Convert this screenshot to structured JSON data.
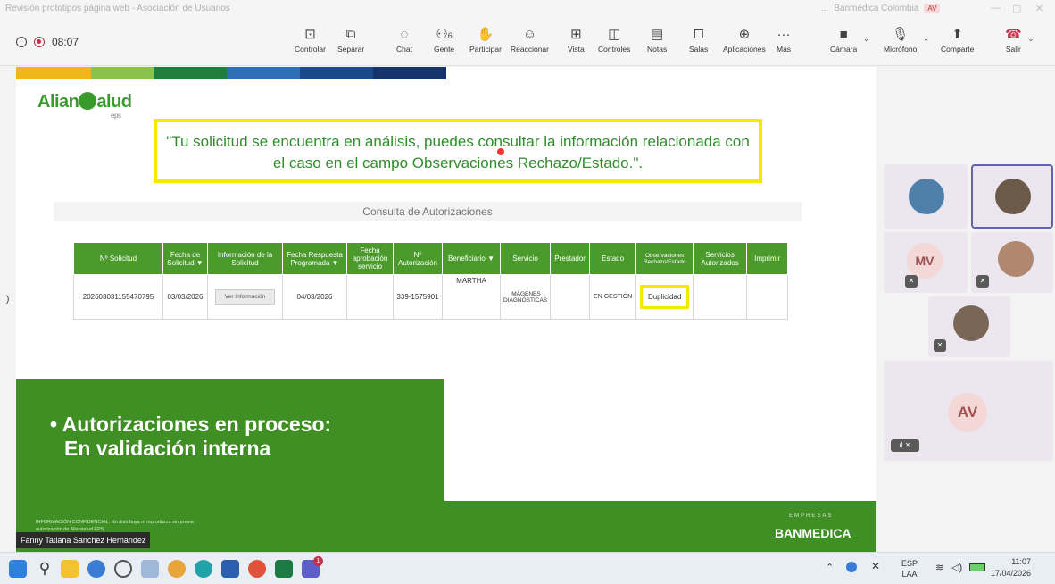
{
  "window": {
    "title": "Revisión prototipos página web - Asociación de Usuarios",
    "org_label": "Banmédica Colombia",
    "user_initials": "AV",
    "ellipsis": "..."
  },
  "meeting": {
    "elapsed": "08:07",
    "participants_count": "6",
    "tools": [
      {
        "label": "Controlar",
        "icon": "control-icon"
      },
      {
        "label": "Separar",
        "icon": "popout-icon"
      },
      {
        "label": "Chat",
        "icon": "chat-icon"
      },
      {
        "label": "Gente",
        "icon": "people-icon"
      },
      {
        "label": "Participar",
        "icon": "raise-hand-icon"
      },
      {
        "label": "Reaccionar",
        "icon": "react-icon"
      },
      {
        "label": "Vista",
        "icon": "view-icon"
      },
      {
        "label": "Controles",
        "icon": "controls-icon"
      },
      {
        "label": "Notas",
        "icon": "notes-icon"
      },
      {
        "label": "Salas",
        "icon": "rooms-icon"
      },
      {
        "label": "Aplicaciones",
        "icon": "apps-icon"
      },
      {
        "label": "Más",
        "icon": "more-icon"
      },
      {
        "label": "Cámara",
        "icon": "camera-off-icon"
      },
      {
        "label": "Micrófono",
        "icon": "mic-off-icon"
      },
      {
        "label": "Comparte",
        "icon": "share-icon"
      },
      {
        "label": "Salir",
        "icon": "leave-icon"
      }
    ]
  },
  "slide": {
    "logo_text_a": "Alian",
    "logo_text_b": "alud",
    "logo_sub": "eps",
    "quote": "\"Tu solicitud se encuentra en análisis, puedes consultar la información relacionada con el caso en el campo Observaciones Rechazo/Estado.\".",
    "consulta_title": "Consulta de Autorizaciones",
    "table": {
      "headers": [
        "Nº Solicitud",
        "Fecha de Solicitud",
        "Información de la Solicitud",
        "Fecha Respuesta Programada",
        "Fecha aprobación servicio",
        "Nº Autorización",
        "Beneficiario",
        "Servicio",
        "Prestador",
        "Estado",
        "Observaciones Rechazo/Estado",
        "Servicios Autorizados",
        "Imprimir"
      ],
      "row": {
        "solicitud": "202603031155470795",
        "fecha_solicitud": "03/03/2026",
        "ver_info": "Ver Información",
        "fecha_respuesta": "04/03/2026",
        "fecha_aprobacion": "",
        "autorizacion": "339-1575901",
        "beneficiario": "MARTHA",
        "servicio": "IMÁGENES DIAGNÓSTICAS",
        "prestador": "",
        "estado": "EN GESTIÓN",
        "observaciones": "Duplicidad",
        "servicios_autorizados": "",
        "imprimir": ""
      }
    },
    "bullet_line1": "• Autorizaciones en proceso:",
    "bullet_line2": "En validación interna",
    "footer_conf": "INFORMACIÓN CONFIDENCIAL. No distribuya ni reproduzca sin previa autorización de Aliansalud EPS.",
    "footer_empresas": "EMPRESAS",
    "footer_brand": "BANMEDICA",
    "speaker": "Fanny Tatiana Sanchez Hernandez",
    "left_marker": ")"
  },
  "participants": [
    {
      "initials": "",
      "mic": "on"
    },
    {
      "initials": "",
      "mic": "on"
    },
    {
      "initials": "MV",
      "mic": "off"
    },
    {
      "initials": "",
      "mic": "off"
    },
    {
      "initials": "",
      "mic": "off"
    },
    {
      "initials": "AV",
      "mic": "off"
    }
  ],
  "taskbar": {
    "lang": "ESP",
    "lang_sub": "LAA",
    "time": "11:07",
    "date": "17/04/2026",
    "teams_badge": "1"
  },
  "colors": {
    "slide_green": "#3f8f25",
    "highlight_yellow": "#f5e900",
    "leave_red": "#c4314b",
    "teams_purple": "#6264a7"
  }
}
